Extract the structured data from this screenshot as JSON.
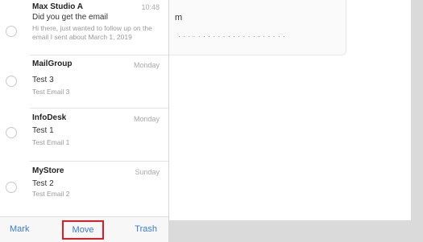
{
  "messages": [
    {
      "from": "Max Studio A",
      "date": "10:48",
      "subject": "Did you get the email",
      "preview1": "Hi there, just wanted to follow up on the",
      "preview2": "email I sent about March 1, 2019"
    },
    {
      "from": "MailGroup",
      "date": "Monday",
      "subject": "Test 3",
      "preview1": "Test Email 3",
      "preview2": ""
    },
    {
      "from": "InfoDesk",
      "date": "Monday",
      "subject": "Test 1",
      "preview1": "Test Email 1",
      "preview2": ""
    },
    {
      "from": "MyStore",
      "date": "Sunday",
      "subject": "Test 2",
      "preview1": "Test Email 2",
      "preview2": ""
    }
  ],
  "toolbar": {
    "mark": "Mark",
    "move": "Move",
    "trash": "Trash"
  },
  "detail": {
    "line1": "m",
    "line2": "· · · · · ·  · · · · · · · · · · · · · · · ·"
  }
}
